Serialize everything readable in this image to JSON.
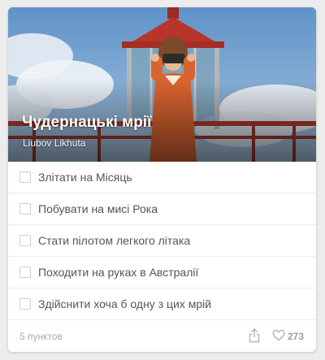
{
  "card": {
    "title": "Чудернацькі мрії",
    "author": "Liubov Likhuta"
  },
  "checklist": {
    "items": [
      {
        "label": "Злітати на Місяць",
        "checked": false
      },
      {
        "label": "Побувати на мисі Рока",
        "checked": false
      },
      {
        "label": "Стати пілотом легкого літака",
        "checked": false
      },
      {
        "label": "Походити на руках в Австралії",
        "checked": false
      },
      {
        "label": "Здійснити хоча б одну з цих мрій",
        "checked": false
      }
    ]
  },
  "footer": {
    "count_label": "5 пунктов",
    "likes": "273",
    "share_icon": "share-icon",
    "like_icon": "heart-icon"
  },
  "colors": {
    "card_bg": "#ffffff",
    "page_bg": "#ececec",
    "item_text": "#555555",
    "muted_text": "#a8a8a8",
    "sky": "#7fa9cf",
    "dress": "#d8642f",
    "lighthouse_red": "#b8352b"
  }
}
